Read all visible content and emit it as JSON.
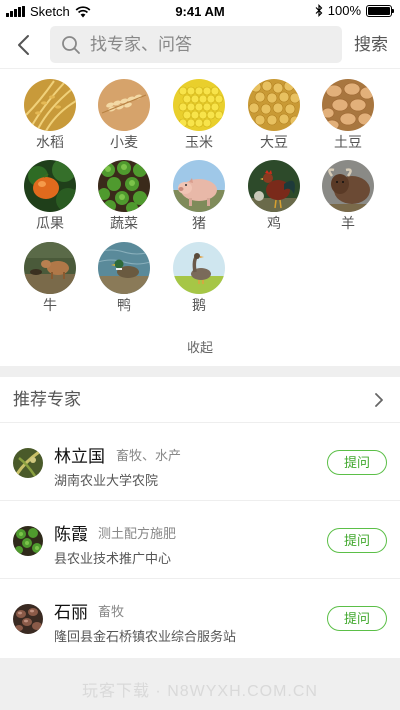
{
  "status_bar": {
    "carrier": "Sketch",
    "time": "9:41 AM",
    "battery": "100%",
    "battery_level": 1.0
  },
  "search": {
    "placeholder": "找专家、问答",
    "button_label": "搜索"
  },
  "categories": [
    {
      "label": "水稻",
      "icon": "rice-image"
    },
    {
      "label": "小麦",
      "icon": "wheat-image"
    },
    {
      "label": "玉米",
      "icon": "corn-image"
    },
    {
      "label": "大豆",
      "icon": "soybean-image"
    },
    {
      "label": "土豆",
      "icon": "potato-image"
    },
    {
      "label": "瓜果",
      "icon": "fruit-image"
    },
    {
      "label": "蔬菜",
      "icon": "vegetable-image"
    },
    {
      "label": "猪",
      "icon": "pig-image"
    },
    {
      "label": "鸡",
      "icon": "chicken-image"
    },
    {
      "label": "羊",
      "icon": "sheep-image"
    },
    {
      "label": "牛",
      "icon": "cattle-image"
    },
    {
      "label": "鸭",
      "icon": "duck-image"
    },
    {
      "label": "鹅",
      "icon": "goose-image"
    }
  ],
  "collapse_label": "收起",
  "experts_section": {
    "title": "推荐专家",
    "experts": [
      {
        "name": "林立国",
        "tags": "畜牧、水产",
        "org": "湖南农业大学农院",
        "ask_label": "提问"
      },
      {
        "name": "陈霞",
        "tags": "测土配方施肥",
        "org": "县农业技术推广中心",
        "ask_label": "提问"
      },
      {
        "name": "石丽",
        "tags": "畜牧",
        "org": "隆回县金石桥镇农业综合服务站",
        "ask_label": "提问"
      }
    ]
  },
  "watermark": "玩客下载 · N8WYXH.COM.CN",
  "colors": {
    "accent_green": "#3fa72b",
    "background": "#efefef",
    "panel": "#ffffff"
  }
}
